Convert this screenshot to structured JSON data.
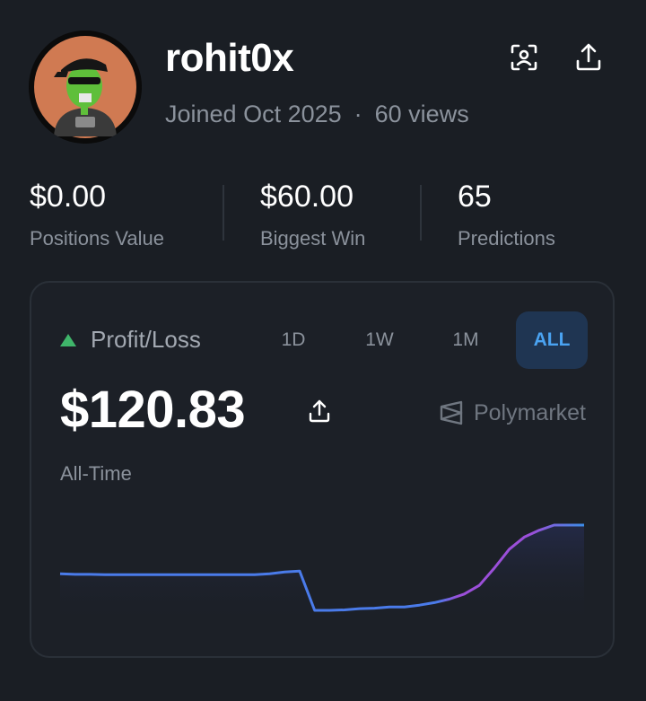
{
  "profile": {
    "username": "rohit0x",
    "joined": "Joined Oct 2025",
    "separator": "·",
    "views": "60 views",
    "icons": [
      "face-scan-icon",
      "share-icon"
    ]
  },
  "stats": [
    {
      "value": "$0.00",
      "label": "Positions Value"
    },
    {
      "value": "$60.00",
      "label": "Biggest Win"
    },
    {
      "value": "65",
      "label": "Predictions"
    }
  ],
  "pnl": {
    "label": "Profit/Loss",
    "trend_color": "#3fb56a",
    "tabs": [
      "1D",
      "1W",
      "1M",
      "ALL"
    ],
    "active_tab": "ALL",
    "amount": "$120.83",
    "brand": "Polymarket",
    "period": "All-Time"
  },
  "chart_data": {
    "type": "line",
    "title": "",
    "xlabel": "",
    "ylabel": "",
    "x": [
      0,
      1,
      2,
      3,
      4,
      5,
      6,
      7,
      8,
      9,
      10,
      11,
      12,
      13,
      14,
      15,
      16,
      17,
      18,
      19,
      20,
      21,
      22,
      23,
      24,
      25,
      26,
      27,
      28,
      29,
      30,
      31,
      32,
      33,
      34,
      35
    ],
    "values": [
      1.5,
      0.8,
      0.8,
      0.5,
      0.5,
      0.5,
      0.5,
      0.5,
      0.5,
      0.5,
      0.5,
      0.5,
      0.5,
      0.5,
      1.5,
      3.5,
      4.5,
      -41,
      -41,
      -40.5,
      -39,
      -38.5,
      -37,
      -37,
      -35,
      -32,
      -28,
      -22,
      -12,
      8,
      30,
      44,
      52,
      58,
      58,
      58
    ],
    "colors": [
      "#4a7bea",
      "#9b4fd9",
      "#3b8de8"
    ]
  }
}
